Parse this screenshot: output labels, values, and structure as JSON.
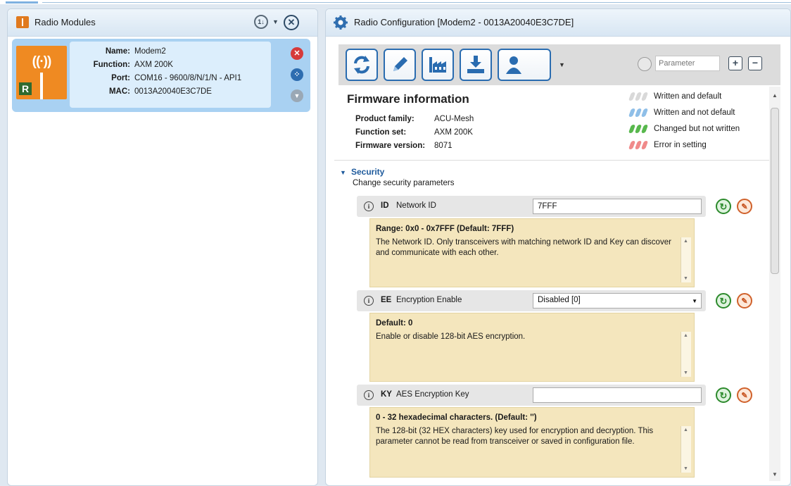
{
  "modules_panel": {
    "title": "Radio Modules",
    "module": {
      "name_label": "Name:",
      "name": "Modem2",
      "function_label": "Function:",
      "function": "AXM 200K",
      "port_label": "Port:",
      "port": "COM16 - 9600/8/N/1/N - API1",
      "mac_label": "MAC:",
      "mac": "0013A20040E3C7DE",
      "badge_letter": "R"
    }
  },
  "config_panel": {
    "title": "Radio Configuration [Modem2 - 0013A20040E3C7DE]",
    "search_placeholder": "Parameter",
    "firmware": {
      "title": "Firmware information",
      "product_family_label": "Product family:",
      "product_family": "ACU-Mesh",
      "function_set_label": "Function set:",
      "function_set": "AXM 200K",
      "firmware_version_label": "Firmware version:",
      "firmware_version": "8071"
    },
    "legend": [
      {
        "label": "Written and default",
        "color": "#d9d9d9"
      },
      {
        "label": "Written and not default",
        "color": "#8fbfe8"
      },
      {
        "label": "Changed but not written",
        "color": "#58b84d"
      },
      {
        "label": "Error in setting",
        "color": "#f08a8a"
      }
    ],
    "section": {
      "title": "Security",
      "description": "Change security parameters"
    },
    "params": [
      {
        "code": "ID",
        "name": "Network ID",
        "value": "7FFF",
        "help_header": "Range: 0x0 - 0x7FFF (Default: 7FFF)",
        "help_text": "The Network ID.  Only transceivers with matching network ID and Key can discover and communicate with each other."
      },
      {
        "code": "EE",
        "name": "Encryption Enable",
        "value": "Disabled [0]",
        "help_header": "Default: 0",
        "help_text": "Enable or disable 128-bit AES encryption."
      },
      {
        "code": "KY",
        "name": "AES Encryption Key",
        "value": "",
        "help_header": "0 - 32 hexadecimal characters. (Default: '')",
        "help_text": "The 128-bit (32 HEX characters) key used for encryption and decryption. This parameter cannot be read from transceiver or saved in configuration file."
      }
    ]
  }
}
